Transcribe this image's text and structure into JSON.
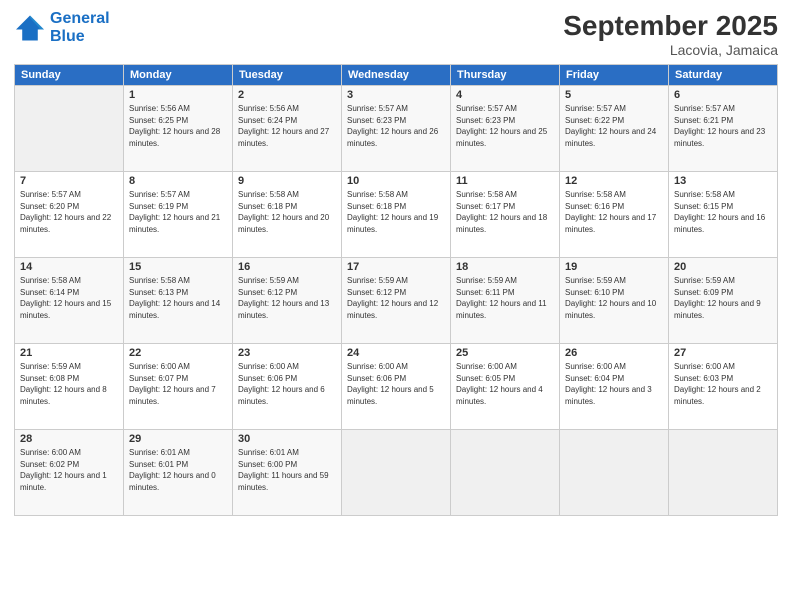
{
  "header": {
    "logo_line1": "General",
    "logo_line2": "Blue",
    "month": "September 2025",
    "location": "Lacovia, Jamaica"
  },
  "weekdays": [
    "Sunday",
    "Monday",
    "Tuesday",
    "Wednesday",
    "Thursday",
    "Friday",
    "Saturday"
  ],
  "weeks": [
    [
      {
        "day": "",
        "sunrise": "",
        "sunset": "",
        "daylight": ""
      },
      {
        "day": "1",
        "sunrise": "Sunrise: 5:56 AM",
        "sunset": "Sunset: 6:25 PM",
        "daylight": "Daylight: 12 hours and 28 minutes."
      },
      {
        "day": "2",
        "sunrise": "Sunrise: 5:56 AM",
        "sunset": "Sunset: 6:24 PM",
        "daylight": "Daylight: 12 hours and 27 minutes."
      },
      {
        "day": "3",
        "sunrise": "Sunrise: 5:57 AM",
        "sunset": "Sunset: 6:23 PM",
        "daylight": "Daylight: 12 hours and 26 minutes."
      },
      {
        "day": "4",
        "sunrise": "Sunrise: 5:57 AM",
        "sunset": "Sunset: 6:23 PM",
        "daylight": "Daylight: 12 hours and 25 minutes."
      },
      {
        "day": "5",
        "sunrise": "Sunrise: 5:57 AM",
        "sunset": "Sunset: 6:22 PM",
        "daylight": "Daylight: 12 hours and 24 minutes."
      },
      {
        "day": "6",
        "sunrise": "Sunrise: 5:57 AM",
        "sunset": "Sunset: 6:21 PM",
        "daylight": "Daylight: 12 hours and 23 minutes."
      }
    ],
    [
      {
        "day": "7",
        "sunrise": "Sunrise: 5:57 AM",
        "sunset": "Sunset: 6:20 PM",
        "daylight": "Daylight: 12 hours and 22 minutes."
      },
      {
        "day": "8",
        "sunrise": "Sunrise: 5:57 AM",
        "sunset": "Sunset: 6:19 PM",
        "daylight": "Daylight: 12 hours and 21 minutes."
      },
      {
        "day": "9",
        "sunrise": "Sunrise: 5:58 AM",
        "sunset": "Sunset: 6:18 PM",
        "daylight": "Daylight: 12 hours and 20 minutes."
      },
      {
        "day": "10",
        "sunrise": "Sunrise: 5:58 AM",
        "sunset": "Sunset: 6:18 PM",
        "daylight": "Daylight: 12 hours and 19 minutes."
      },
      {
        "day": "11",
        "sunrise": "Sunrise: 5:58 AM",
        "sunset": "Sunset: 6:17 PM",
        "daylight": "Daylight: 12 hours and 18 minutes."
      },
      {
        "day": "12",
        "sunrise": "Sunrise: 5:58 AM",
        "sunset": "Sunset: 6:16 PM",
        "daylight": "Daylight: 12 hours and 17 minutes."
      },
      {
        "day": "13",
        "sunrise": "Sunrise: 5:58 AM",
        "sunset": "Sunset: 6:15 PM",
        "daylight": "Daylight: 12 hours and 16 minutes."
      }
    ],
    [
      {
        "day": "14",
        "sunrise": "Sunrise: 5:58 AM",
        "sunset": "Sunset: 6:14 PM",
        "daylight": "Daylight: 12 hours and 15 minutes."
      },
      {
        "day": "15",
        "sunrise": "Sunrise: 5:58 AM",
        "sunset": "Sunset: 6:13 PM",
        "daylight": "Daylight: 12 hours and 14 minutes."
      },
      {
        "day": "16",
        "sunrise": "Sunrise: 5:59 AM",
        "sunset": "Sunset: 6:12 PM",
        "daylight": "Daylight: 12 hours and 13 minutes."
      },
      {
        "day": "17",
        "sunrise": "Sunrise: 5:59 AM",
        "sunset": "Sunset: 6:12 PM",
        "daylight": "Daylight: 12 hours and 12 minutes."
      },
      {
        "day": "18",
        "sunrise": "Sunrise: 5:59 AM",
        "sunset": "Sunset: 6:11 PM",
        "daylight": "Daylight: 12 hours and 11 minutes."
      },
      {
        "day": "19",
        "sunrise": "Sunrise: 5:59 AM",
        "sunset": "Sunset: 6:10 PM",
        "daylight": "Daylight: 12 hours and 10 minutes."
      },
      {
        "day": "20",
        "sunrise": "Sunrise: 5:59 AM",
        "sunset": "Sunset: 6:09 PM",
        "daylight": "Daylight: 12 hours and 9 minutes."
      }
    ],
    [
      {
        "day": "21",
        "sunrise": "Sunrise: 5:59 AM",
        "sunset": "Sunset: 6:08 PM",
        "daylight": "Daylight: 12 hours and 8 minutes."
      },
      {
        "day": "22",
        "sunrise": "Sunrise: 6:00 AM",
        "sunset": "Sunset: 6:07 PM",
        "daylight": "Daylight: 12 hours and 7 minutes."
      },
      {
        "day": "23",
        "sunrise": "Sunrise: 6:00 AM",
        "sunset": "Sunset: 6:06 PM",
        "daylight": "Daylight: 12 hours and 6 minutes."
      },
      {
        "day": "24",
        "sunrise": "Sunrise: 6:00 AM",
        "sunset": "Sunset: 6:06 PM",
        "daylight": "Daylight: 12 hours and 5 minutes."
      },
      {
        "day": "25",
        "sunrise": "Sunrise: 6:00 AM",
        "sunset": "Sunset: 6:05 PM",
        "daylight": "Daylight: 12 hours and 4 minutes."
      },
      {
        "day": "26",
        "sunrise": "Sunrise: 6:00 AM",
        "sunset": "Sunset: 6:04 PM",
        "daylight": "Daylight: 12 hours and 3 minutes."
      },
      {
        "day": "27",
        "sunrise": "Sunrise: 6:00 AM",
        "sunset": "Sunset: 6:03 PM",
        "daylight": "Daylight: 12 hours and 2 minutes."
      }
    ],
    [
      {
        "day": "28",
        "sunrise": "Sunrise: 6:00 AM",
        "sunset": "Sunset: 6:02 PM",
        "daylight": "Daylight: 12 hours and 1 minute."
      },
      {
        "day": "29",
        "sunrise": "Sunrise: 6:01 AM",
        "sunset": "Sunset: 6:01 PM",
        "daylight": "Daylight: 12 hours and 0 minutes."
      },
      {
        "day": "30",
        "sunrise": "Sunrise: 6:01 AM",
        "sunset": "Sunset: 6:00 PM",
        "daylight": "Daylight: 11 hours and 59 minutes."
      },
      {
        "day": "",
        "sunrise": "",
        "sunset": "",
        "daylight": ""
      },
      {
        "day": "",
        "sunrise": "",
        "sunset": "",
        "daylight": ""
      },
      {
        "day": "",
        "sunrise": "",
        "sunset": "",
        "daylight": ""
      },
      {
        "day": "",
        "sunrise": "",
        "sunset": "",
        "daylight": ""
      }
    ]
  ]
}
